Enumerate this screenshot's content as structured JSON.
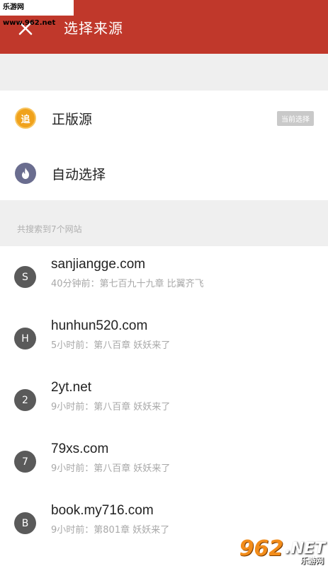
{
  "watermark_top": "乐游网 www.962.net",
  "app_bar": {
    "title": "选择来源",
    "close_icon": "close-icon",
    "background": "#c0382b"
  },
  "options": [
    {
      "label": "正版源",
      "icon": "zhui-badge-icon",
      "icon_text": "追",
      "icon_color": "#f0a21c",
      "badge": "当前选择"
    },
    {
      "label": "自动选择",
      "icon": "flame-icon",
      "icon_color": "#6a6d8f"
    }
  ],
  "section_header": "共搜索到7个网站",
  "sources": [
    {
      "initial": "S",
      "name": "sanjiangge.com",
      "subtitle": "40分钟前：第七百九十九章 比翼齐飞"
    },
    {
      "initial": "H",
      "name": "hunhun520.com",
      "subtitle": "5小时前：第八百章 妖妖来了"
    },
    {
      "initial": "2",
      "name": "2yt.net",
      "subtitle": "9小时前：第八百章 妖妖来了"
    },
    {
      "initial": "7",
      "name": "79xs.com",
      "subtitle": "9小时前：第八百章 妖妖来了"
    },
    {
      "initial": "B",
      "name": "book.my716.com",
      "subtitle": "9小时前：第801章 妖妖来了"
    }
  ],
  "watermark_bottom": {
    "num": "962",
    "net": ".NET",
    "cn": "乐游网"
  }
}
